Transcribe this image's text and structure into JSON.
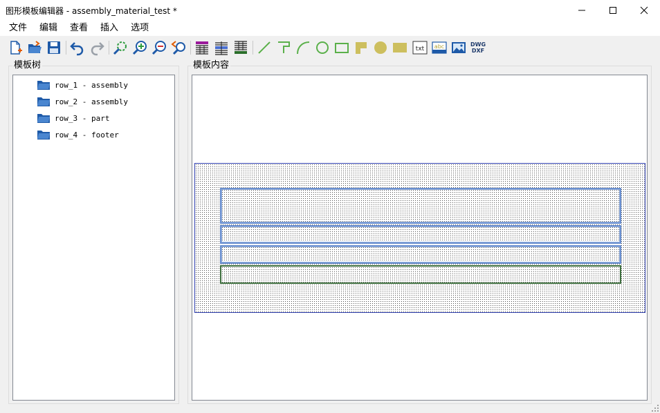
{
  "window": {
    "title": "图形模板编辑器 - assembly_material_test *",
    "minimize_icon": "minimize-icon",
    "maximize_icon": "maximize-icon",
    "close_icon": "close-icon"
  },
  "menu": {
    "items": [
      "文件",
      "编辑",
      "查看",
      "插入",
      "选项"
    ]
  },
  "toolbar": {
    "icons": [
      "new-file-icon",
      "open-folder-icon",
      "save-icon",
      "undo-icon",
      "redo-icon",
      "zoom-fit-icon",
      "zoom-in-icon",
      "zoom-out-icon",
      "zoom-previous-icon",
      "table-icon-1",
      "table-icon-2",
      "table-icon-3",
      "line-icon",
      "polyline-icon",
      "arc-icon",
      "circle-icon",
      "rectangle-icon",
      "filled-polygon-icon",
      "filled-circle-icon",
      "filled-rectangle-icon",
      "text-icon",
      "label-text-icon",
      "image-icon",
      "dwg-dxf-icon"
    ],
    "txt_label": "txt",
    "abc_label": "abc",
    "dwg_label": "DWG",
    "dxf_label": "DXF"
  },
  "tree": {
    "title": "模板树",
    "items": [
      {
        "label": "row_1 - assembly"
      },
      {
        "label": "row_2 - assembly"
      },
      {
        "label": "row_3 - part"
      },
      {
        "label": "row_4 - footer"
      }
    ]
  },
  "content": {
    "title": "模板内容",
    "rows": [
      {
        "name": "row_1",
        "type": "assembly",
        "color": "#6a8fcf"
      },
      {
        "name": "row_2",
        "type": "assembly",
        "color": "#6a8fcf"
      },
      {
        "name": "row_3",
        "type": "part",
        "color": "#6a8fcf"
      },
      {
        "name": "row_4",
        "type": "footer",
        "color": "#3d6e3d"
      }
    ],
    "outer_border_color": "#3040b0"
  }
}
